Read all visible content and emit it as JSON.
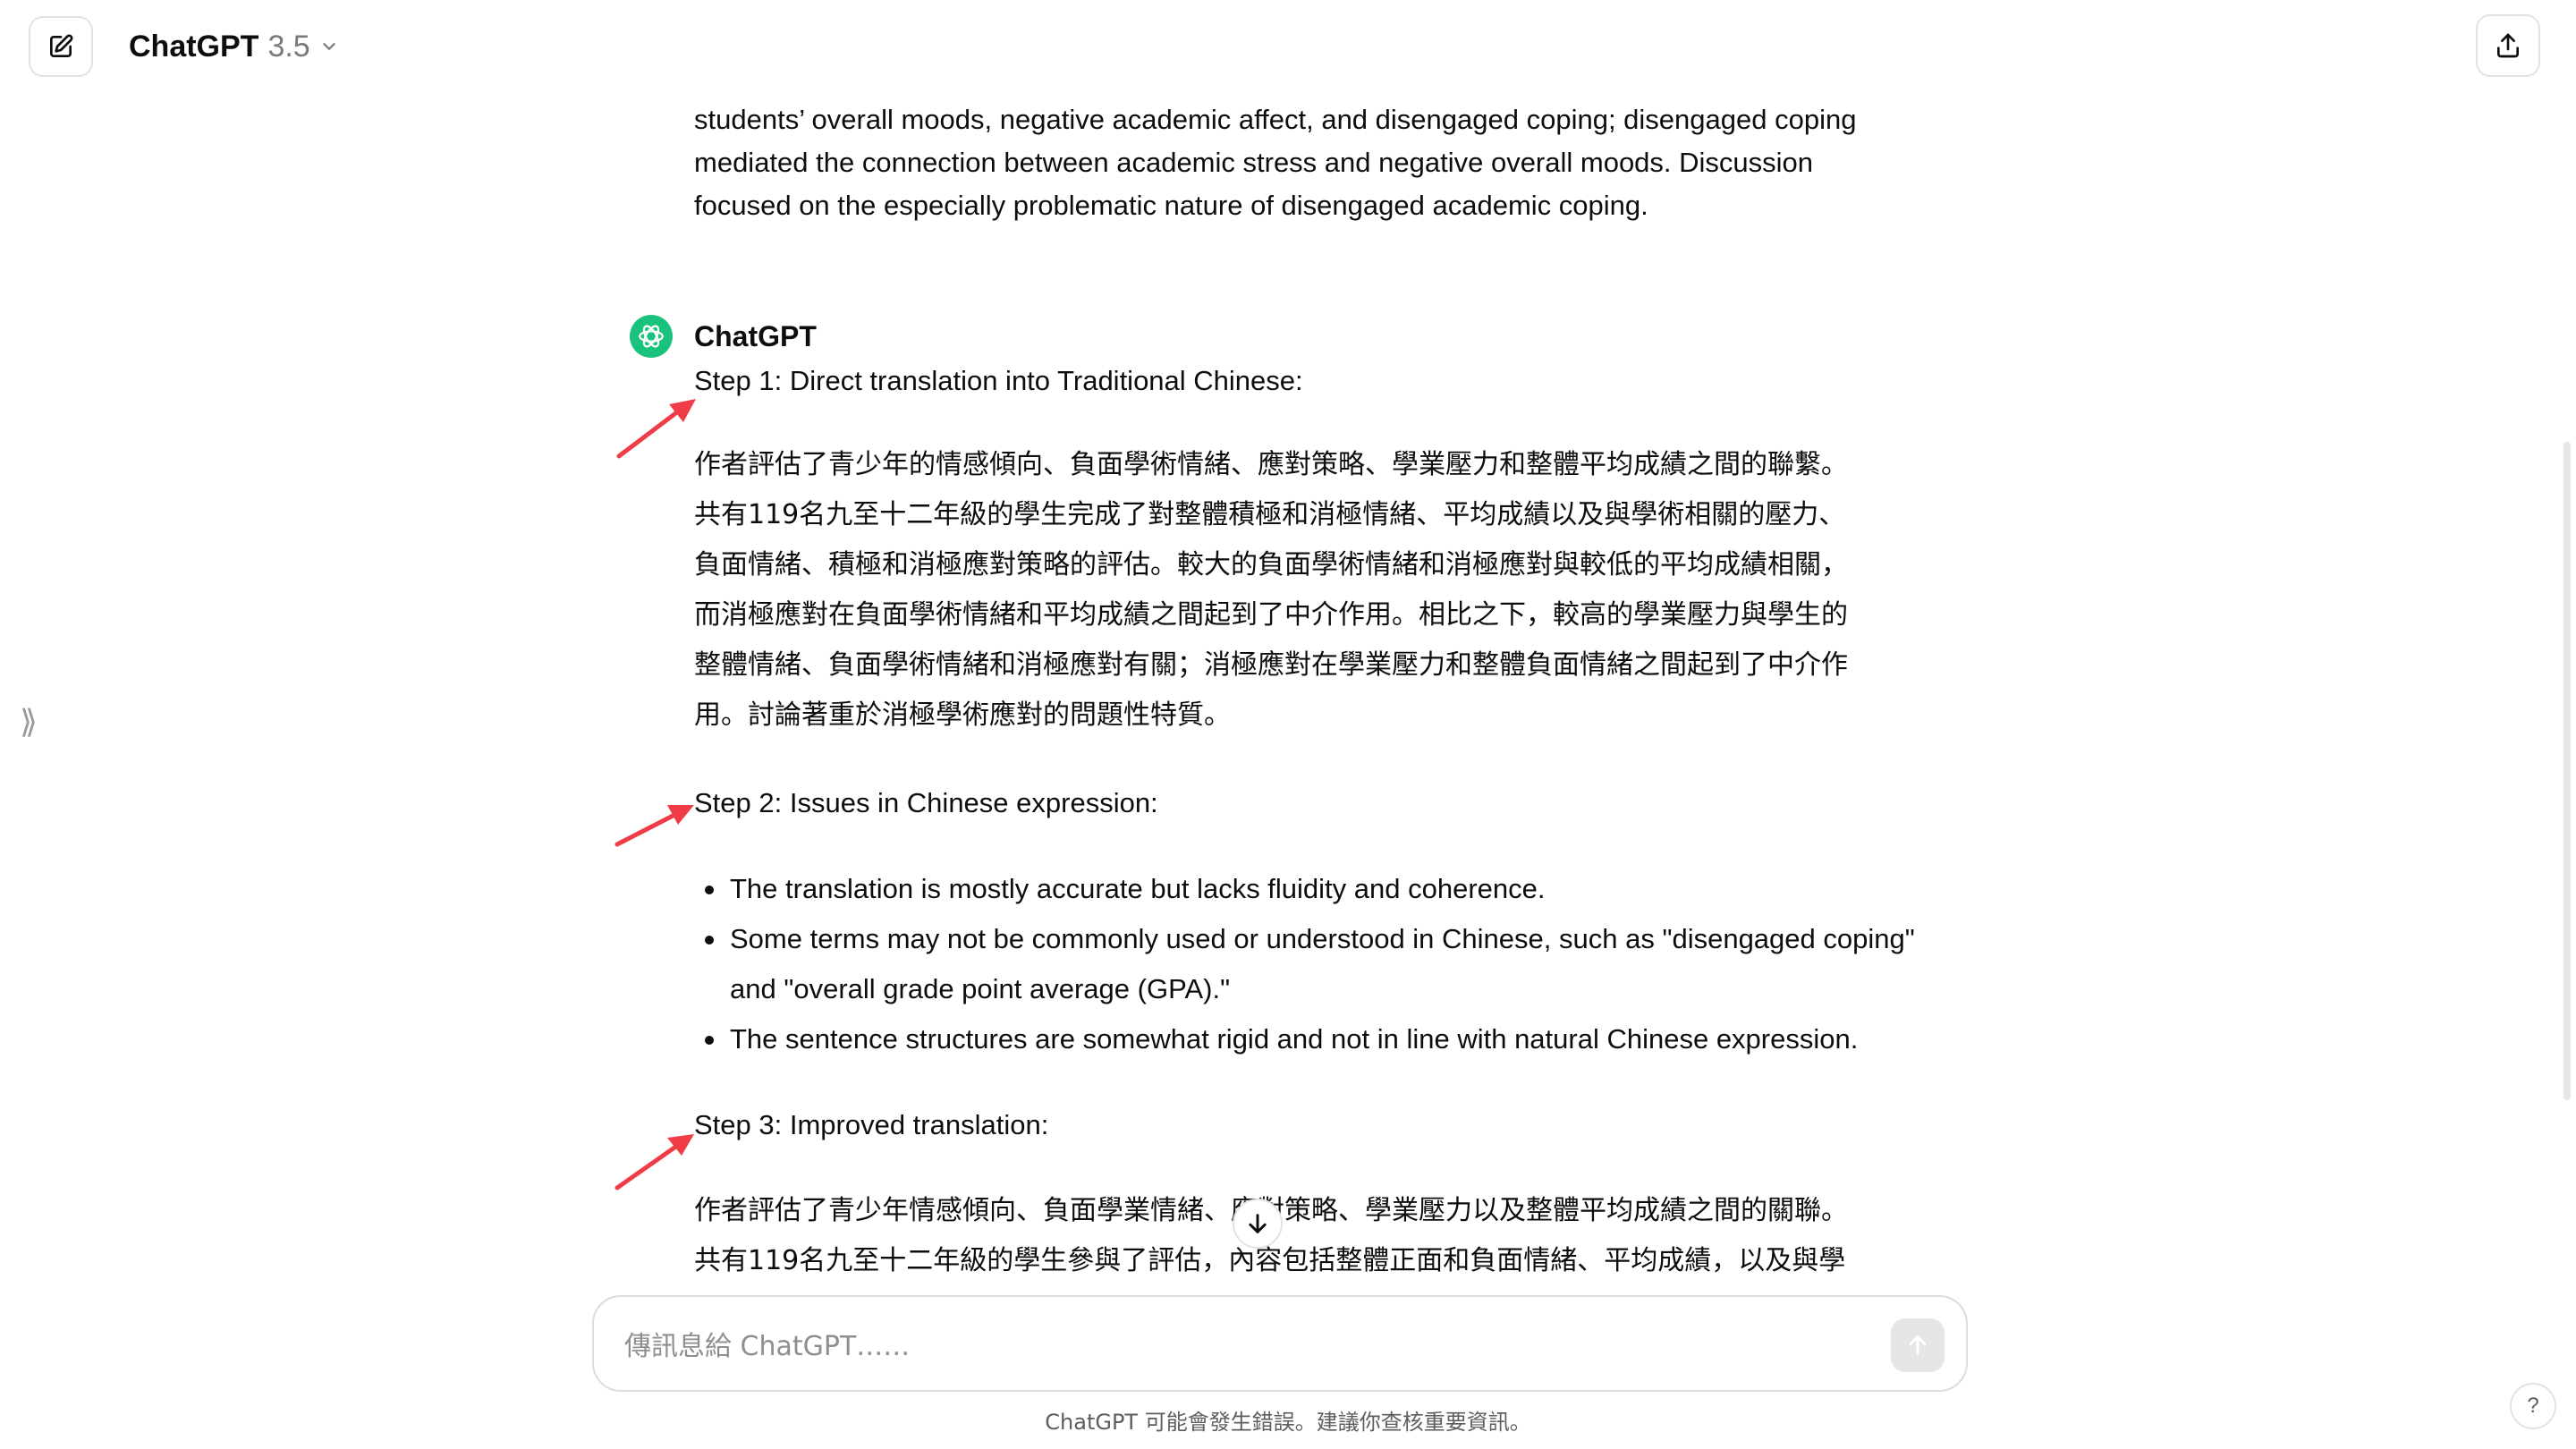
{
  "header": {
    "model_name": "ChatGPT",
    "model_version": "3.5",
    "new_chat_icon": "pencil-square-icon",
    "share_icon": "share-upload-icon"
  },
  "conversation": {
    "user_message_tail": [
      "students’ overall moods, negative academic affect, and disengaged coping; disengaged coping",
      "mediated the connection between academic stress and negative overall moods. Discussion",
      "focused on the especially problematic nature of disengaged academic coping."
    ],
    "assistant": {
      "name": "ChatGPT",
      "step1_heading": "Step 1: Direct translation into Traditional Chinese:",
      "step1_text": [
        "作者評估了青少年的情感傾向、負面學術情緒、應對策略、學業壓力和整體平均成績之間的聯繫。",
        "共有119名九至十二年級的學生完成了對整體積極和消極情緒、平均成績以及與學術相關的壓力、",
        "負面情緒、積極和消極應對策略的評估。較大的負面學術情緒和消極應對與較低的平均成績相關，",
        "而消極應對在負面學術情緒和平均成績之間起到了中介作用。相比之下，較高的學業壓力與學生的",
        "整體情緒、負面學術情緒和消極應對有關；消極應對在學業壓力和整體負面情緒之間起到了中介作",
        "用。討論著重於消極學術應對的問題性特質。"
      ],
      "step2_heading": "Step 2: Issues in Chinese expression:",
      "step2_items": [
        "The translation is mostly accurate but lacks fluidity and coherence.",
        "Some terms may not be commonly used or understood in Chinese, such as \"disengaged coping\" and \"overall grade point average (GPA).\"",
        "The sentence structures are somewhat rigid and not in line with natural Chinese expression."
      ],
      "step3_heading": "Step 3: Improved translation:",
      "step3_text": [
        "作者評估了青少年情感傾向、負面學業情緒、應對策略、學業壓力以及整體平均成績之間的關聯。",
        "共有119名九至十二年級的學生參與了評估，內容包括整體正面和負面情緒、平均成績，以及與學"
      ]
    }
  },
  "composer": {
    "placeholder": "傳訊息給 ChatGPT……",
    "send_icon": "arrow-up-icon",
    "disclaimer": "ChatGPT 可能會發生錯誤。建議你查核重要資訊。"
  },
  "misc": {
    "help_label": "?",
    "sidebar_toggle_glyph": "⟫",
    "annotation_arrow_color": "#f03c46",
    "accent_green": "#19c37d"
  }
}
